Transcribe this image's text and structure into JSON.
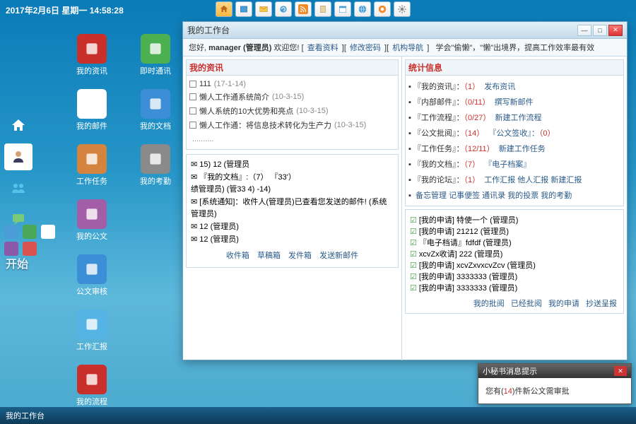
{
  "datetime": "2017年2月6日 星期一  14:58:28",
  "start_label": "开始",
  "taskbar_item": "我的工作台",
  "desktop_col1": [
    {
      "label": "我的资讯",
      "color": "#c9302c"
    },
    {
      "label": "我的邮件",
      "color": "#fff"
    },
    {
      "label": "工作任务",
      "color": "#d4843e"
    },
    {
      "label": "我的公文",
      "color": "#a35ea8"
    },
    {
      "label": "公文审核",
      "color": "#3c8ed6"
    },
    {
      "label": "工作汇报",
      "color": "#55b4e4"
    },
    {
      "label": "我的流程",
      "color": "#c9302c"
    }
  ],
  "desktop_col2": [
    {
      "label": "即时通讯",
      "color": "#4caf50"
    },
    {
      "label": "我的文档",
      "color": "#3c8ed6"
    },
    {
      "label": "我的考勤",
      "color": "#8a8a8a"
    }
  ],
  "window": {
    "title": "我的工作台",
    "greet_pre": "您好,",
    "greet_user": "manager (管理员)",
    "greet_welcome": "欢迎您!",
    "links": [
      "查看资料",
      "修改密码",
      "机构导航"
    ],
    "motto": "学会\"偷懒\"，\"懒\"出境界，提高工作效率最有效",
    "left_section_title": "我的资讯",
    "news_items": [
      {
        "title": "111",
        "meta": "(17-1-14)"
      },
      {
        "title": "懒人工作通系统简介",
        "meta": "(10-3-15)"
      },
      {
        "title": "懒人系统的10大优势和亮点",
        "meta": "(10-3-15)"
      },
      {
        "title": "懒人工作通：将信息技术转化为生产力",
        "meta": "(10-3-15)"
      }
    ],
    "mail": {
      "line1": "  15)    12          (管理员",
      "line2": "『我的文档』:（7）    『33'）",
      "line3": "绩管理员)                (管33  4)         -14)",
      "line4": "[系统通知]：收件人(管理员)已查看您发送的邮件! (系统管理员)",
      "line5": "12 (管理员)",
      "line6": "12 (管理员)",
      "footer": [
        "收件箱",
        "草稿箱",
        "发件箱",
        "发送新邮件"
      ]
    },
    "stats_title": "统计信息",
    "stats": [
      {
        "lbl": "『我的资讯』：",
        "num": "（1）",
        "action": "发布资讯"
      },
      {
        "lbl": "『内部邮件』：",
        "num": "（0/11）",
        "action": "撰写新邮件"
      },
      {
        "lbl": "『工作流程』：",
        "num": "（0/27）",
        "action": "新建工作流程"
      },
      {
        "lbl": "『公文批阅』：",
        "num": "（14）",
        "action": "『公文签收』：",
        "num2": "（0）"
      },
      {
        "lbl": "『工作任务』：",
        "num": "（12/11）",
        "action": "新建工作任务"
      },
      {
        "lbl": "『我的文档』：",
        "num": "（7）",
        "action": "『电子档案』"
      },
      {
        "lbl": "『我的论坛』：",
        "num": "（1）",
        "action": "工作汇报  他人汇报  新建汇报"
      },
      {
        "lbl": "",
        "num": "",
        "action": "备忘管理  记事便签  通讯录  我的投票  我的考勤"
      }
    ],
    "approvals": [
      "[我的申请] 特使一个 (管理员)",
      "[我的申请] 21212 (管理员)",
      "『电子档请』fdfdf (管理员)",
      "xcvZx收请] 222 (管理员)",
      "[我的申请] xcvZxvxcvZcv (管理员)",
      "[我的申请] 3333333 (管理员)",
      "[我的申请] 3333333 (管理员)"
    ],
    "approval_footer": [
      "我的批阅",
      "已经批阅",
      "我的申请",
      "抄送呈报"
    ]
  },
  "notif": {
    "title": "小秘书消息提示",
    "body_pre": "您有(",
    "body_count": "14",
    "body_post": ")件新公文需审批"
  }
}
